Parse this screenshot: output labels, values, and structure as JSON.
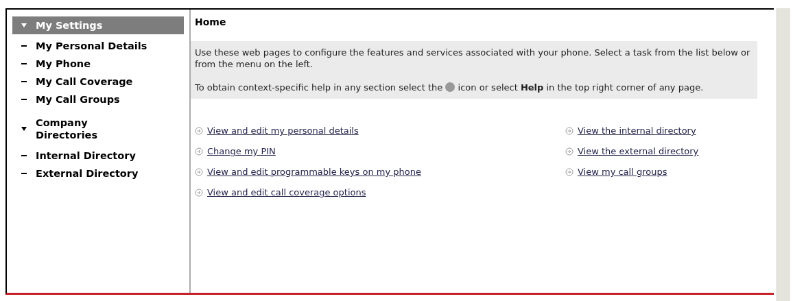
{
  "sidebar": {
    "sections": [
      {
        "label": "My Settings",
        "expanded": true,
        "selected": true,
        "children": [
          {
            "label": "My Personal Details"
          },
          {
            "label": "My Phone"
          },
          {
            "label": "My Call Coverage"
          },
          {
            "label": "My Call Groups"
          }
        ]
      },
      {
        "label": "Company Directories",
        "expanded": true,
        "selected": false,
        "children": [
          {
            "label": "Internal Directory"
          },
          {
            "label": "External Directory"
          }
        ]
      }
    ]
  },
  "page": {
    "title": "Home",
    "intro": "Use these web pages to configure the features and services associated with your phone. Select a task from the list below or from the menu on the left.",
    "help_before": "To obtain context-specific help in any section select the",
    "help_after": "icon or select **Help** in the top right corner of any page."
  },
  "links": {
    "column_1": [
      "View and edit my personal details",
      "Change my PIN",
      "View and edit programmable keys on my phone",
      "View and edit call coverage options"
    ],
    "column_2": [
      "View the internal directory",
      "View the external directory",
      "View my call groups"
    ]
  }
}
